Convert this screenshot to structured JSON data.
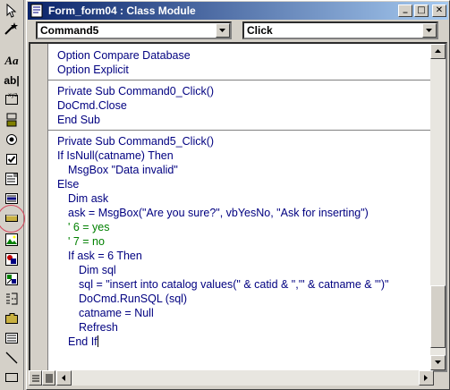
{
  "window": {
    "title": "Form_form04 : Class Module",
    "min_glyph": "_",
    "restore_glyph": "□",
    "close_glyph": "✕"
  },
  "combos": {
    "object_value": "Command5",
    "procedure_value": "Click"
  },
  "code_lines": [
    {
      "text": "Option Compare Database",
      "indent": 0,
      "kind": "code"
    },
    {
      "text": "Option Explicit",
      "indent": 0,
      "kind": "code"
    },
    {
      "text": "",
      "indent": 0,
      "kind": "separator"
    },
    {
      "text": "Private Sub Command0_Click()",
      "indent": 0,
      "kind": "code"
    },
    {
      "text": "DoCmd.Close",
      "indent": 0,
      "kind": "code"
    },
    {
      "text": "End Sub",
      "indent": 0,
      "kind": "code"
    },
    {
      "text": "",
      "indent": 0,
      "kind": "separator"
    },
    {
      "text": "Private Sub Command5_Click()",
      "indent": 0,
      "kind": "code"
    },
    {
      "text": "If IsNull(catname) Then",
      "indent": 0,
      "kind": "code"
    },
    {
      "text": "MsgBox \"Data invalid\"",
      "indent": 1,
      "kind": "code"
    },
    {
      "text": "Else",
      "indent": 0,
      "kind": "code"
    },
    {
      "text": "Dim ask",
      "indent": 1,
      "kind": "code"
    },
    {
      "text": "ask = MsgBox(\"Are you sure?\", vbYesNo, \"Ask for inserting\")",
      "indent": 1,
      "kind": "code"
    },
    {
      "text": "' 6 = yes",
      "indent": 1,
      "kind": "comment"
    },
    {
      "text": "' 7 = no",
      "indent": 1,
      "kind": "comment"
    },
    {
      "text": "If ask = 6 Then",
      "indent": 1,
      "kind": "code"
    },
    {
      "text": "Dim sql",
      "indent": 2,
      "kind": "code"
    },
    {
      "text": "sql = \"insert into catalog values(\" & catid & \",'\" & catname & \"')\"",
      "indent": 2,
      "kind": "code"
    },
    {
      "text": "DoCmd.RunSQL (sql)",
      "indent": 2,
      "kind": "code"
    },
    {
      "text": "catname = Null",
      "indent": 2,
      "kind": "code"
    },
    {
      "text": "Refresh",
      "indent": 2,
      "kind": "code"
    },
    {
      "text": "End If",
      "indent": 1,
      "kind": "code",
      "caret": true
    }
  ],
  "toolbox": {
    "items": [
      "select-objects-icon",
      "control-wizards-icon",
      "label-icon",
      "text-box-icon",
      "option-group-icon",
      "toggle-button-icon",
      "option-button-icon",
      "check-box-icon",
      "combo-box-icon",
      "list-box-icon",
      "command-button-icon",
      "image-icon",
      "unbound-object-frame-icon",
      "bound-object-frame-icon",
      "page-break-icon",
      "tab-control-icon",
      "subform-icon",
      "line-icon",
      "rectangle-icon"
    ],
    "label_text": "Aa",
    "textbox_text": "ab|",
    "highlighted_item": "command-button-icon",
    "highlight_color": "#d6465c"
  },
  "colors": {
    "code_text": "#000080",
    "comment_text": "#008000",
    "title_start": "#0a246a",
    "title_end": "#a6caf0"
  }
}
